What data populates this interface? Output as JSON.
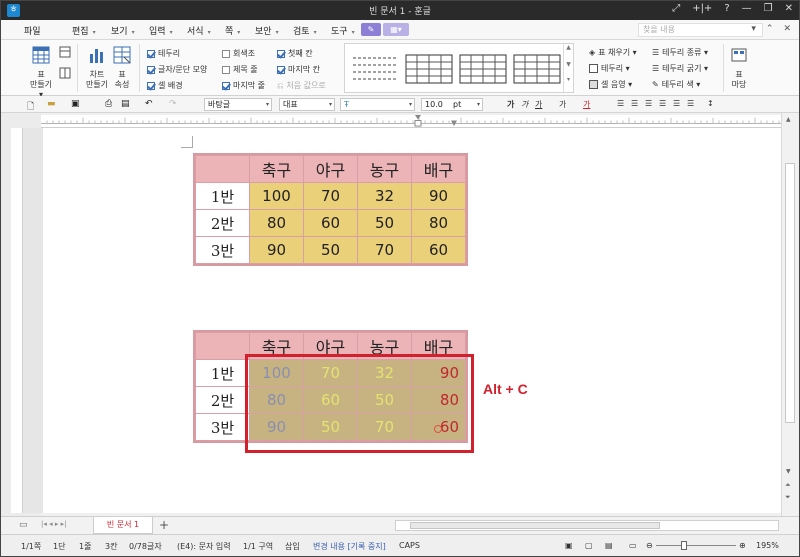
{
  "titlebar": {
    "title": "빈 문서 1 - 훈글",
    "controls": [
      "⤢",
      "+|+",
      "?",
      "—",
      "❐",
      "✕"
    ]
  },
  "menubar": {
    "items": [
      {
        "label": "파일",
        "arrow": ""
      },
      {
        "label": "편집",
        "arrow": "▾"
      },
      {
        "label": "보기",
        "arrow": "▾"
      },
      {
        "label": "입력",
        "arrow": "▾"
      },
      {
        "label": "서식",
        "arrow": "▾"
      },
      {
        "label": "쪽",
        "arrow": "▾"
      },
      {
        "label": "보안",
        "arrow": "▾"
      },
      {
        "label": "검토",
        "arrow": "▾"
      },
      {
        "label": "도구",
        "arrow": "▾"
      }
    ],
    "search_placeholder": "찾을 내용"
  },
  "ribbon": {
    "table_create_label_1": "표",
    "table_create_label_2": "만들기▾",
    "chart_create_label_1": "차트",
    "chart_create_label_2": "만들기",
    "table_props_label_1": "표",
    "table_props_label_2": "속성",
    "checks_col1": [
      {
        "label": "테두리",
        "on": true
      },
      {
        "label": "글자/문단 모양",
        "on": true
      },
      {
        "label": "셀 배경",
        "on": true
      }
    ],
    "checks_col2": [
      {
        "label": "회색조",
        "on": false
      },
      {
        "label": "제목 줄",
        "on": false
      },
      {
        "label": "마지막 줄",
        "on": true
      }
    ],
    "checks_col3": [
      {
        "label": "첫째 칸",
        "on": true
      },
      {
        "label": "마지막 칸",
        "on": true
      },
      {
        "label": "처음 값으로",
        "on": false
      }
    ],
    "right_col1": [
      "표 채우기 ▾",
      "테두리 ▾",
      "셀 음영 ▾"
    ],
    "right_col2": [
      "테두리 종류 ▾",
      "테두리 굵기 ▾",
      "테두리 색 ▾"
    ],
    "margin_label_1": "표",
    "margin_label_2": "마당"
  },
  "toolbar": {
    "style_combo": "바탕글",
    "font_lang_combo": "대표",
    "font_combo": "",
    "size_value": "10.0",
    "size_unit": "pt"
  },
  "table1": {
    "headers": [
      "축구",
      "야구",
      "농구",
      "배구"
    ],
    "rows": [
      {
        "label": "1반",
        "values": [
          "100",
          "70",
          "32",
          "90"
        ]
      },
      {
        "label": "2반",
        "values": [
          "80",
          "60",
          "50",
          "80"
        ]
      },
      {
        "label": "3반",
        "values": [
          "90",
          "50",
          "70",
          "60"
        ]
      }
    ]
  },
  "table2": {
    "headers": [
      "축구",
      "야구",
      "농구",
      "배구"
    ],
    "rows": [
      {
        "label": "1반",
        "values": [
          "100",
          "70",
          "32",
          "90"
        ]
      },
      {
        "label": "2반",
        "values": [
          "80",
          "60",
          "50",
          "80"
        ]
      },
      {
        "label": "3반",
        "values": [
          "90",
          "50",
          "70",
          "60"
        ]
      }
    ]
  },
  "annotation": "Alt + C",
  "tabbar": {
    "doc_tab": "빈 문서 1",
    "add": "+"
  },
  "statusbar": {
    "page": "1/1쪽",
    "section": "1단",
    "line": "1줄",
    "col": "3칸",
    "chars": "0/78글자",
    "cell": "(E4): 문자 입력",
    "area": "1/1 구역",
    "mode": "삽입",
    "track": "변경 내용 [기록 중지]",
    "caps": "CAPS",
    "zoom": "195%"
  },
  "colors": {
    "header_bg": "#edb4b8",
    "cell_bg": "#ebd07a",
    "selected_cell_bg": "#c7b382",
    "annotation_red": "#d2202c"
  }
}
